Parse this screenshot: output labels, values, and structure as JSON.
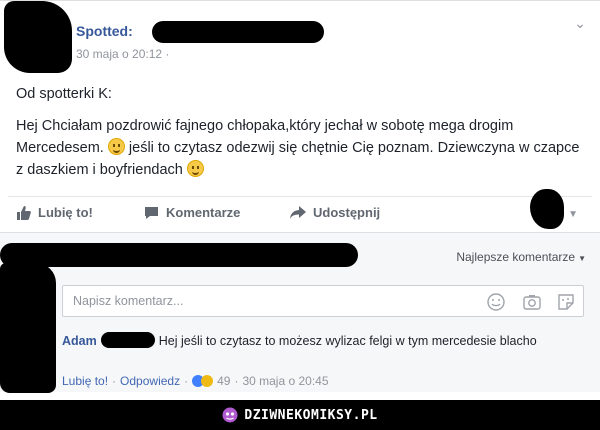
{
  "post": {
    "author": "Spotted:",
    "time": "30 maja o 20:12 ·",
    "intro": "Od spotterki K:",
    "body_line1": "Hej Chciałam pozdrowić fajnego chłopaka,który jechał w sobotę mega drogim Mercedesem. ",
    "body_line2": " jeśli to czytasz odezwij się chętnie Cię poznam. Dziewczyna w czapce z daszkiem i boyfriendach "
  },
  "actions": {
    "like": "Lubię to!",
    "comment": "Komentarze",
    "share": "Udostępnij"
  },
  "comments": {
    "sort_label": "Najlepsze komentarze",
    "input_placeholder": "Napisz komentarz...",
    "item": {
      "author": "Adam",
      "text": "Hej jeśli to czytasz to możesz wylizac felgi w tym mercedesie blacho",
      "like": "Lubię to!",
      "reply": "Odpowiedz",
      "reactions_count": "49",
      "time": "30 maja o 20:45"
    }
  },
  "footer": {
    "site": "DZIWNEKOMIKSY.PL"
  },
  "colors": {
    "link": "#365899",
    "muted": "#90949c",
    "footer_bg": "#000000"
  }
}
